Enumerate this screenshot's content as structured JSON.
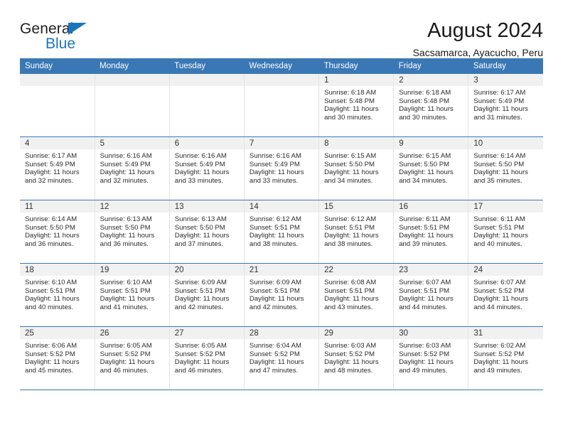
{
  "brand": {
    "name_top": "General",
    "name_bottom": "Blue",
    "triangle_color": "#1b75bb"
  },
  "header": {
    "title": "August 2024",
    "subtitle": "Sacsamarca, Ayacucho, Peru"
  },
  "colors": {
    "header_blue": "#3a78b5",
    "daynum_band": "#f1f1f1",
    "grid_line": "#e3e3e3",
    "row_line": "#3a78b5",
    "brand_blue": "#1b75bb"
  },
  "weekday_headers": [
    "Sunday",
    "Monday",
    "Tuesday",
    "Wednesday",
    "Thursday",
    "Friday",
    "Saturday"
  ],
  "labels": {
    "sunrise_prefix": "Sunrise:",
    "sunset_prefix": "Sunset:",
    "daylight_prefix": "Daylight:"
  },
  "weeks": [
    [
      {
        "day": "",
        "sunrise": "",
        "sunset": "",
        "daylight_line1": "",
        "daylight_line2": ""
      },
      {
        "day": "",
        "sunrise": "",
        "sunset": "",
        "daylight_line1": "",
        "daylight_line2": ""
      },
      {
        "day": "",
        "sunrise": "",
        "sunset": "",
        "daylight_line1": "",
        "daylight_line2": ""
      },
      {
        "day": "",
        "sunrise": "",
        "sunset": "",
        "daylight_line1": "",
        "daylight_line2": ""
      },
      {
        "day": "1",
        "sunrise": "Sunrise: 6:18 AM",
        "sunset": "Sunset: 5:48 PM",
        "daylight_line1": "Daylight: 11 hours",
        "daylight_line2": "and 30 minutes."
      },
      {
        "day": "2",
        "sunrise": "Sunrise: 6:18 AM",
        "sunset": "Sunset: 5:48 PM",
        "daylight_line1": "Daylight: 11 hours",
        "daylight_line2": "and 30 minutes."
      },
      {
        "day": "3",
        "sunrise": "Sunrise: 6:17 AM",
        "sunset": "Sunset: 5:49 PM",
        "daylight_line1": "Daylight: 11 hours",
        "daylight_line2": "and 31 minutes."
      }
    ],
    [
      {
        "day": "4",
        "sunrise": "Sunrise: 6:17 AM",
        "sunset": "Sunset: 5:49 PM",
        "daylight_line1": "Daylight: 11 hours",
        "daylight_line2": "and 32 minutes."
      },
      {
        "day": "5",
        "sunrise": "Sunrise: 6:16 AM",
        "sunset": "Sunset: 5:49 PM",
        "daylight_line1": "Daylight: 11 hours",
        "daylight_line2": "and 32 minutes."
      },
      {
        "day": "6",
        "sunrise": "Sunrise: 6:16 AM",
        "sunset": "Sunset: 5:49 PM",
        "daylight_line1": "Daylight: 11 hours",
        "daylight_line2": "and 33 minutes."
      },
      {
        "day": "7",
        "sunrise": "Sunrise: 6:16 AM",
        "sunset": "Sunset: 5:49 PM",
        "daylight_line1": "Daylight: 11 hours",
        "daylight_line2": "and 33 minutes."
      },
      {
        "day": "8",
        "sunrise": "Sunrise: 6:15 AM",
        "sunset": "Sunset: 5:50 PM",
        "daylight_line1": "Daylight: 11 hours",
        "daylight_line2": "and 34 minutes."
      },
      {
        "day": "9",
        "sunrise": "Sunrise: 6:15 AM",
        "sunset": "Sunset: 5:50 PM",
        "daylight_line1": "Daylight: 11 hours",
        "daylight_line2": "and 34 minutes."
      },
      {
        "day": "10",
        "sunrise": "Sunrise: 6:14 AM",
        "sunset": "Sunset: 5:50 PM",
        "daylight_line1": "Daylight: 11 hours",
        "daylight_line2": "and 35 minutes."
      }
    ],
    [
      {
        "day": "11",
        "sunrise": "Sunrise: 6:14 AM",
        "sunset": "Sunset: 5:50 PM",
        "daylight_line1": "Daylight: 11 hours",
        "daylight_line2": "and 36 minutes."
      },
      {
        "day": "12",
        "sunrise": "Sunrise: 6:13 AM",
        "sunset": "Sunset: 5:50 PM",
        "daylight_line1": "Daylight: 11 hours",
        "daylight_line2": "and 36 minutes."
      },
      {
        "day": "13",
        "sunrise": "Sunrise: 6:13 AM",
        "sunset": "Sunset: 5:50 PM",
        "daylight_line1": "Daylight: 11 hours",
        "daylight_line2": "and 37 minutes."
      },
      {
        "day": "14",
        "sunrise": "Sunrise: 6:12 AM",
        "sunset": "Sunset: 5:51 PM",
        "daylight_line1": "Daylight: 11 hours",
        "daylight_line2": "and 38 minutes."
      },
      {
        "day": "15",
        "sunrise": "Sunrise: 6:12 AM",
        "sunset": "Sunset: 5:51 PM",
        "daylight_line1": "Daylight: 11 hours",
        "daylight_line2": "and 38 minutes."
      },
      {
        "day": "16",
        "sunrise": "Sunrise: 6:11 AM",
        "sunset": "Sunset: 5:51 PM",
        "daylight_line1": "Daylight: 11 hours",
        "daylight_line2": "and 39 minutes."
      },
      {
        "day": "17",
        "sunrise": "Sunrise: 6:11 AM",
        "sunset": "Sunset: 5:51 PM",
        "daylight_line1": "Daylight: 11 hours",
        "daylight_line2": "and 40 minutes."
      }
    ],
    [
      {
        "day": "18",
        "sunrise": "Sunrise: 6:10 AM",
        "sunset": "Sunset: 5:51 PM",
        "daylight_line1": "Daylight: 11 hours",
        "daylight_line2": "and 40 minutes."
      },
      {
        "day": "19",
        "sunrise": "Sunrise: 6:10 AM",
        "sunset": "Sunset: 5:51 PM",
        "daylight_line1": "Daylight: 11 hours",
        "daylight_line2": "and 41 minutes."
      },
      {
        "day": "20",
        "sunrise": "Sunrise: 6:09 AM",
        "sunset": "Sunset: 5:51 PM",
        "daylight_line1": "Daylight: 11 hours",
        "daylight_line2": "and 42 minutes."
      },
      {
        "day": "21",
        "sunrise": "Sunrise: 6:09 AM",
        "sunset": "Sunset: 5:51 PM",
        "daylight_line1": "Daylight: 11 hours",
        "daylight_line2": "and 42 minutes."
      },
      {
        "day": "22",
        "sunrise": "Sunrise: 6:08 AM",
        "sunset": "Sunset: 5:51 PM",
        "daylight_line1": "Daylight: 11 hours",
        "daylight_line2": "and 43 minutes."
      },
      {
        "day": "23",
        "sunrise": "Sunrise: 6:07 AM",
        "sunset": "Sunset: 5:51 PM",
        "daylight_line1": "Daylight: 11 hours",
        "daylight_line2": "and 44 minutes."
      },
      {
        "day": "24",
        "sunrise": "Sunrise: 6:07 AM",
        "sunset": "Sunset: 5:52 PM",
        "daylight_line1": "Daylight: 11 hours",
        "daylight_line2": "and 44 minutes."
      }
    ],
    [
      {
        "day": "25",
        "sunrise": "Sunrise: 6:06 AM",
        "sunset": "Sunset: 5:52 PM",
        "daylight_line1": "Daylight: 11 hours",
        "daylight_line2": "and 45 minutes."
      },
      {
        "day": "26",
        "sunrise": "Sunrise: 6:05 AM",
        "sunset": "Sunset: 5:52 PM",
        "daylight_line1": "Daylight: 11 hours",
        "daylight_line2": "and 46 minutes."
      },
      {
        "day": "27",
        "sunrise": "Sunrise: 6:05 AM",
        "sunset": "Sunset: 5:52 PM",
        "daylight_line1": "Daylight: 11 hours",
        "daylight_line2": "and 46 minutes."
      },
      {
        "day": "28",
        "sunrise": "Sunrise: 6:04 AM",
        "sunset": "Sunset: 5:52 PM",
        "daylight_line1": "Daylight: 11 hours",
        "daylight_line2": "and 47 minutes."
      },
      {
        "day": "29",
        "sunrise": "Sunrise: 6:03 AM",
        "sunset": "Sunset: 5:52 PM",
        "daylight_line1": "Daylight: 11 hours",
        "daylight_line2": "and 48 minutes."
      },
      {
        "day": "30",
        "sunrise": "Sunrise: 6:03 AM",
        "sunset": "Sunset: 5:52 PM",
        "daylight_line1": "Daylight: 11 hours",
        "daylight_line2": "and 49 minutes."
      },
      {
        "day": "31",
        "sunrise": "Sunrise: 6:02 AM",
        "sunset": "Sunset: 5:52 PM",
        "daylight_line1": "Daylight: 11 hours",
        "daylight_line2": "and 49 minutes."
      }
    ]
  ]
}
